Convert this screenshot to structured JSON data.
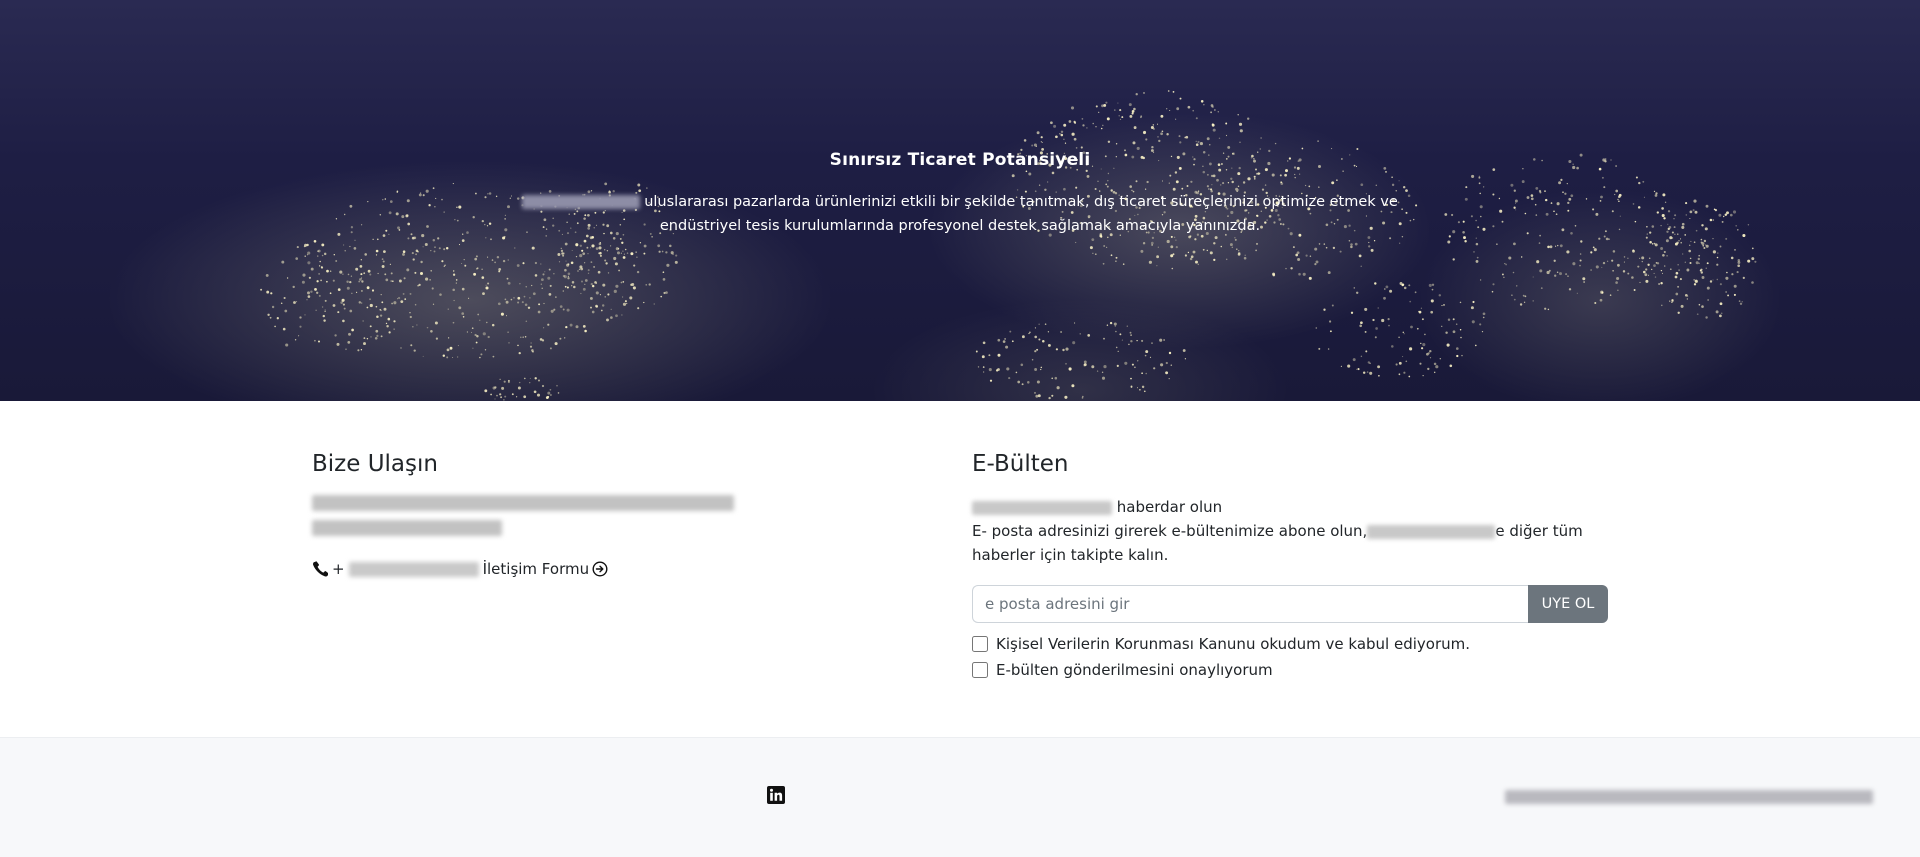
{
  "hero": {
    "title": "Sınırsız Ticaret Potansiyeli",
    "description": "uluslararası pazarlarda ürünlerinizi etkili bir şekilde tanıtmak, dış ticaret süreçlerinizi optimize etmek ve endüstriyel tesis kurulumlarında profesyonel destek sağlamak amacıyla yanınızda."
  },
  "contact": {
    "title": "Bize Ulaşın",
    "phone_prefix": "+",
    "form_link": "İletişim Formu"
  },
  "newsletter": {
    "title": "E-Bülten",
    "intro_suffix": "haberdar olun",
    "description_before": "E- posta adresinizi girerek e-bültenimize abone olun,",
    "description_after": "e diğer tüm haberler için takipte kalın.",
    "email_placeholder": "e posta adresini gir",
    "subscribe_button": "UYE OL",
    "kvkk_link": "Kişisel Verilerin Korunması",
    "kvkk_text": "Kanunu okudum ve kabul ediyorum.",
    "consent_text": "E-bülten gönderilmesini onaylıyorum"
  },
  "footer": {
    "social_icon": "linkedin-icon"
  },
  "colors": {
    "hero_bg": "#1e1e44",
    "button_bg": "#6c757d",
    "footer_bg": "#f7f8fa"
  }
}
